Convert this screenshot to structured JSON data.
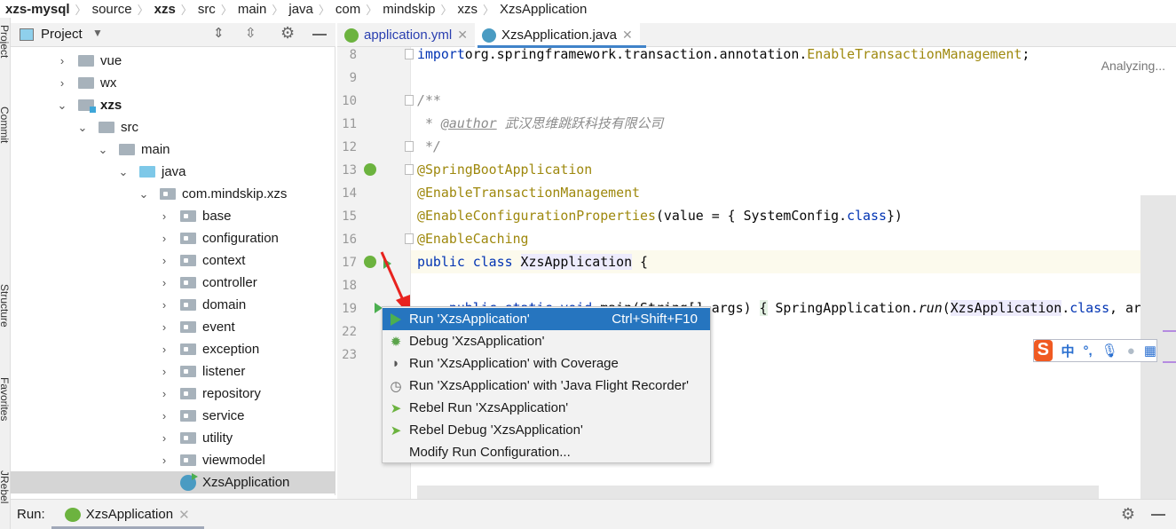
{
  "breadcrumb": [
    "xzs-mysql",
    "source",
    "xzs",
    "src",
    "main",
    "java",
    "com",
    "mindskip",
    "xzs",
    "XzsApplication"
  ],
  "side_stripe": [
    "Project",
    "Commit",
    "Structure",
    "Favorites",
    "JRebel"
  ],
  "project_panel": {
    "title": "Project",
    "icons": [
      "expand-all-icon",
      "collapse-all-icon",
      "gear-icon",
      "minimize-icon"
    ]
  },
  "tree": [
    {
      "label": "vue",
      "depth": 0,
      "state": "collapsed",
      "icon": "folder"
    },
    {
      "label": "wx",
      "depth": 0,
      "state": "collapsed",
      "icon": "folder"
    },
    {
      "label": "xzs",
      "depth": 0,
      "state": "expanded",
      "icon": "module",
      "bold": true
    },
    {
      "label": "src",
      "depth": 1,
      "state": "expanded",
      "icon": "folder"
    },
    {
      "label": "main",
      "depth": 2,
      "state": "expanded",
      "icon": "folder"
    },
    {
      "label": "java",
      "depth": 3,
      "state": "expanded",
      "icon": "source-folder"
    },
    {
      "label": "com.mindskip.xzs",
      "depth": 4,
      "state": "expanded",
      "icon": "package"
    },
    {
      "label": "base",
      "depth": 5,
      "state": "collapsed",
      "icon": "package"
    },
    {
      "label": "configuration",
      "depth": 5,
      "state": "collapsed",
      "icon": "package"
    },
    {
      "label": "context",
      "depth": 5,
      "state": "collapsed",
      "icon": "package"
    },
    {
      "label": "controller",
      "depth": 5,
      "state": "collapsed",
      "icon": "package"
    },
    {
      "label": "domain",
      "depth": 5,
      "state": "collapsed",
      "icon": "package"
    },
    {
      "label": "event",
      "depth": 5,
      "state": "collapsed",
      "icon": "package"
    },
    {
      "label": "exception",
      "depth": 5,
      "state": "collapsed",
      "icon": "package"
    },
    {
      "label": "listener",
      "depth": 5,
      "state": "collapsed",
      "icon": "package"
    },
    {
      "label": "repository",
      "depth": 5,
      "state": "collapsed",
      "icon": "package"
    },
    {
      "label": "service",
      "depth": 5,
      "state": "collapsed",
      "icon": "package"
    },
    {
      "label": "utility",
      "depth": 5,
      "state": "collapsed",
      "icon": "package"
    },
    {
      "label": "viewmodel",
      "depth": 5,
      "state": "collapsed",
      "icon": "package"
    },
    {
      "label": "XzsApplication",
      "depth": 5,
      "state": "leaf",
      "icon": "spring-class",
      "selected": true
    }
  ],
  "tabs": [
    {
      "label": "application.yml",
      "active": false
    },
    {
      "label": "XzsApplication.java",
      "active": true
    }
  ],
  "editor": {
    "status": "Analyzing...",
    "lines": [
      {
        "n": "8",
        "tokens": [
          [
            "kw",
            "import"
          ],
          [
            "",
            "org.springframework.transaction.annotation."
          ],
          [
            "an",
            "EnableTransactionManagement"
          ],
          [
            "",
            ";"
          ]
        ]
      },
      {
        "n": "9",
        "tokens": []
      },
      {
        "n": "10",
        "tokens": [
          [
            "cm",
            "/**"
          ]
        ]
      },
      {
        "n": "11",
        "tokens": [
          [
            "cm",
            " * "
          ],
          [
            "tg",
            "@author"
          ],
          [
            "cm",
            " 武汉思维跳跃科技有限公司"
          ]
        ]
      },
      {
        "n": "12",
        "tokens": [
          [
            "cm",
            " */"
          ]
        ]
      },
      {
        "n": "13",
        "tokens": [
          [
            "an",
            "@SpringBootApplication"
          ]
        ]
      },
      {
        "n": "14",
        "tokens": [
          [
            "an",
            "@EnableTransactionManagement"
          ]
        ]
      },
      {
        "n": "15",
        "tokens": [
          [
            "an",
            "@EnableConfigurationProperties"
          ],
          [
            "",
            "(value = { SystemConfig."
          ],
          [
            "kw",
            "class"
          ],
          [
            "",
            "})"
          ]
        ]
      },
      {
        "n": "16",
        "tokens": [
          [
            "an",
            "@EnableCaching"
          ]
        ]
      },
      {
        "n": "17",
        "tokens": [
          [
            "kw",
            "public class "
          ],
          [
            "hl",
            "XzsApplication"
          ],
          [
            "",
            " {"
          ]
        ]
      },
      {
        "n": "18",
        "tokens": []
      },
      {
        "n": "19",
        "tokens": [
          [
            "",
            "    "
          ],
          [
            "kw",
            "public static void "
          ],
          [
            "",
            "main(String[] args) "
          ],
          [
            "br",
            "{"
          ],
          [
            "",
            " SpringApplication."
          ],
          [
            "it",
            "run"
          ],
          [
            "",
            "("
          ],
          [
            "hl",
            "XzsApplication"
          ],
          [
            "",
            "."
          ],
          [
            "kw",
            "class"
          ],
          [
            "",
            ", args); "
          ],
          [
            "br",
            "}"
          ]
        ]
      },
      {
        "n": "22",
        "tokens": [
          [
            "",
            "}"
          ]
        ]
      },
      {
        "n": "23",
        "tokens": []
      }
    ]
  },
  "context_menu": [
    {
      "label": "Run 'XzsApplication'",
      "shortcut": "Ctrl+Shift+F10",
      "icon": "run-icon",
      "selected": true
    },
    {
      "label": "Debug 'XzsApplication'",
      "icon": "debug-icon"
    },
    {
      "label": "Run 'XzsApplication' with Coverage",
      "icon": "coverage-icon"
    },
    {
      "label": "Run 'XzsApplication' with 'Java Flight Recorder'",
      "icon": "profiler-icon"
    },
    {
      "label": "Rebel Run 'XzsApplication'",
      "icon": "rebel-run-icon"
    },
    {
      "label": "Rebel Debug 'XzsApplication'",
      "icon": "rebel-debug-icon"
    },
    {
      "label": "Modify Run Configuration...",
      "icon": ""
    }
  ],
  "ime": {
    "mode": "中",
    "punct": "°,"
  },
  "run_bar": {
    "label": "Run:",
    "tab": "XzsApplication"
  },
  "colors": {
    "accent": "#2675bf",
    "arrow": "#e8231f",
    "run_green": "#4caf50"
  }
}
